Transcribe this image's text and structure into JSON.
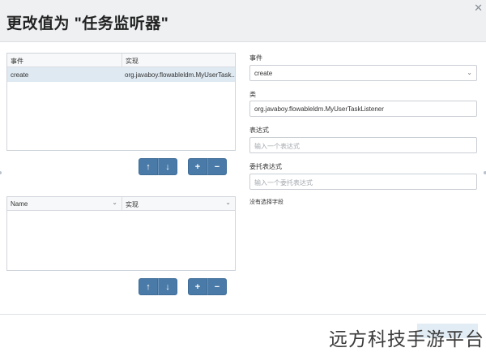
{
  "dialog": {
    "title": "更改值为 \"任务监听器\"",
    "close_glyph": "✕"
  },
  "listeners_table": {
    "headers": [
      "事件",
      "实现"
    ],
    "rows": [
      {
        "event": "create",
        "implementation": "org.javaboy.flowableldm.MyUserTask..."
      }
    ]
  },
  "fields_table": {
    "headers": [
      "Name",
      "实现"
    ]
  },
  "buttons": {
    "up": "↑",
    "down": "↓",
    "add": "+",
    "remove": "−"
  },
  "form": {
    "event_label": "事件",
    "event_value": "create",
    "class_label": "类",
    "class_value": "org.javaboy.flowableldm.MyUserTaskListener",
    "expression_label": "表达式",
    "expression_placeholder": "输入一个表达式",
    "delegate_label": "委托表达式",
    "delegate_placeholder": "输入一个委托表达式",
    "no_field_text": "没有选择字段"
  },
  "watermark": "远方科技手游平台"
}
